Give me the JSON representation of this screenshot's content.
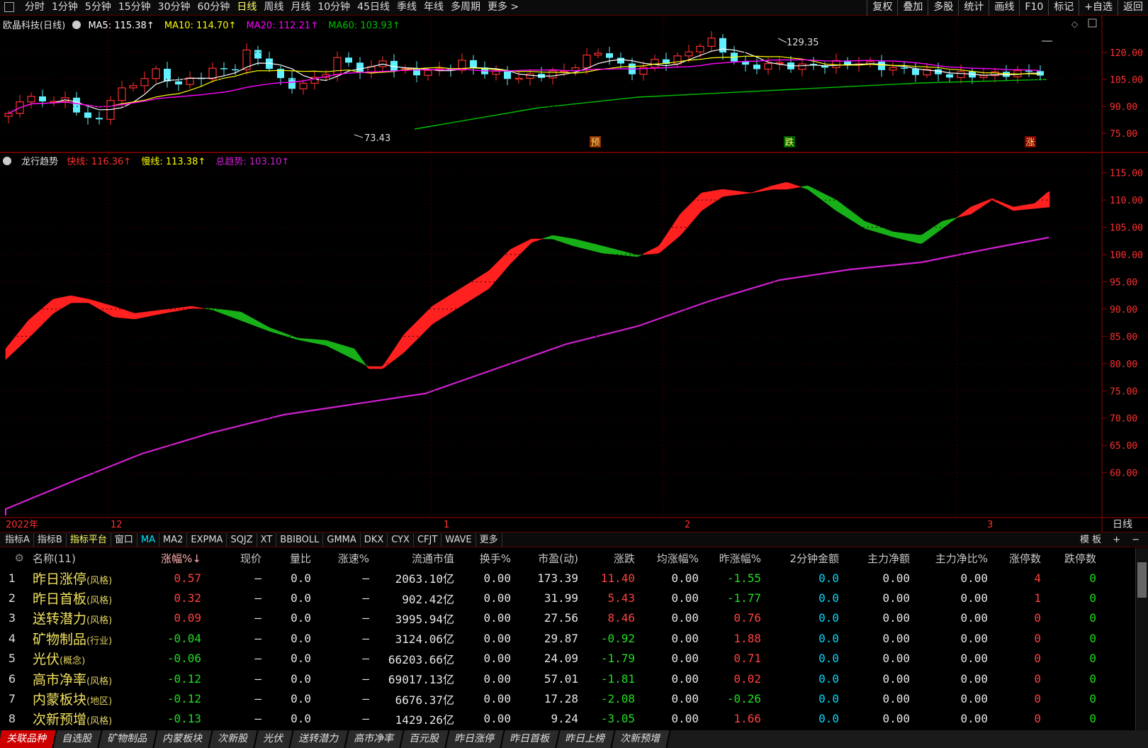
{
  "topbar": {
    "periods": [
      "分时",
      "1分钟",
      "5分钟",
      "15分钟",
      "30分钟",
      "60分钟",
      "日线",
      "周线",
      "月线",
      "10分钟",
      "45日线",
      "季线",
      "年线",
      "多周期",
      "更多 >"
    ],
    "active_period": "日线",
    "tools": [
      "复权",
      "叠加",
      "多股",
      "统计",
      "画线",
      "F10",
      "标记",
      "+自选",
      "返回"
    ]
  },
  "main_legend": {
    "title": "欧晶科技(日线)",
    "ma5": "MA5: 115.38↑",
    "ma10": "MA10: 114.70↑",
    "ma20": "MA20: 112.21↑",
    "ma60": "MA60: 103.93↑"
  },
  "main_chart": {
    "high_label": "129.35",
    "low_label": "73.43",
    "signals": [
      "预",
      "跌",
      "涨"
    ],
    "y_ticks": [
      "120.00",
      "105.00",
      "90.00",
      "75.00"
    ]
  },
  "ind_legend": {
    "title": "龙行趋势",
    "fast": "快线: 116.36↑",
    "slow": "慢线: 113.38↑",
    "total": "总趋势: 103.10↑"
  },
  "ind_chart": {
    "y_ticks": [
      "115.00",
      "110.00",
      "105.00",
      "100.00",
      "95.00",
      "90.00",
      "85.00",
      "80.00",
      "75.00",
      "70.00",
      "65.00",
      "60.00"
    ]
  },
  "x_axis": {
    "labels": [
      "2022年",
      "12",
      "1",
      "2",
      "3"
    ],
    "period": "日线"
  },
  "colors": {
    "up": "#ff2020",
    "down": "#18b018",
    "trend": "#d020d0",
    "ma5": "#ffffff",
    "ma10": "#ffff00",
    "ma20": "#ff00ff",
    "ma60": "#00c000",
    "candle_down": "#60f0ff"
  },
  "indicator_tabs": {
    "tabs": [
      "指标A",
      "指标B",
      "指标平台",
      "窗口",
      "MA",
      "MA2",
      "EXPMA",
      "SQJZ",
      "XT",
      "BBIBOLL",
      "GMMA",
      "DKX",
      "CYX",
      "CFJT",
      "WAVE",
      "更多"
    ],
    "active": "指标平台",
    "right": [
      "模 板",
      "+",
      "−"
    ]
  },
  "table": {
    "headers": [
      "",
      "名称(11)",
      "涨幅%↓",
      "现价",
      "量比",
      "涨速%",
      "流通市值",
      "换手%",
      "市盈(动)",
      "涨跌",
      "均涨幅%",
      "昨涨幅%",
      "2分钟金额",
      "主力净额",
      "主力净比%",
      "涨停数",
      "跌停数"
    ],
    "rows": [
      {
        "idx": "1",
        "name": "昨日涨停",
        "tag": "(风格)",
        "chg": "0.57",
        "price": "—",
        "vr": "0.0",
        "speed": "—",
        "mcap": "2063.10亿",
        "turn": "0.00",
        "pe": "173.39",
        "zd": "11.40",
        "avg": "0.00",
        "yest": "-1.55",
        "amt2": "0.0",
        "net": "0.00",
        "netr": "0.00",
        "up": "4",
        "down": "0"
      },
      {
        "idx": "2",
        "name": "昨日首板",
        "tag": "(风格)",
        "chg": "0.32",
        "price": "—",
        "vr": "0.0",
        "speed": "—",
        "mcap": "902.42亿",
        "turn": "0.00",
        "pe": "31.99",
        "zd": "5.43",
        "avg": "0.00",
        "yest": "-1.77",
        "amt2": "0.0",
        "net": "0.00",
        "netr": "0.00",
        "up": "1",
        "down": "0"
      },
      {
        "idx": "3",
        "name": "送转潜力",
        "tag": "(风格)",
        "chg": "0.09",
        "price": "—",
        "vr": "0.0",
        "speed": "—",
        "mcap": "3995.94亿",
        "turn": "0.00",
        "pe": "27.56",
        "zd": "8.46",
        "avg": "0.00",
        "yest": "0.76",
        "amt2": "0.0",
        "net": "0.00",
        "netr": "0.00",
        "up": "0",
        "down": "0"
      },
      {
        "idx": "4",
        "name": "矿物制品",
        "tag": "(行业)",
        "chg": "-0.04",
        "price": "—",
        "vr": "0.0",
        "speed": "—",
        "mcap": "3124.06亿",
        "turn": "0.00",
        "pe": "29.87",
        "zd": "-0.92",
        "avg": "0.00",
        "yest": "1.88",
        "amt2": "0.0",
        "net": "0.00",
        "netr": "0.00",
        "up": "0",
        "down": "0"
      },
      {
        "idx": "5",
        "name": "光伏",
        "tag": "(概念)",
        "chg": "-0.06",
        "price": "—",
        "vr": "0.0",
        "speed": "—",
        "mcap": "66203.66亿",
        "turn": "0.00",
        "pe": "24.09",
        "zd": "-1.79",
        "avg": "0.00",
        "yest": "0.71",
        "amt2": "0.0",
        "net": "0.00",
        "netr": "0.00",
        "up": "0",
        "down": "0"
      },
      {
        "idx": "6",
        "name": "高市净率",
        "tag": "(风格)",
        "chg": "-0.12",
        "price": "—",
        "vr": "0.0",
        "speed": "—",
        "mcap": "69017.13亿",
        "turn": "0.00",
        "pe": "57.01",
        "zd": "-1.81",
        "avg": "0.00",
        "yest": "0.02",
        "amt2": "0.0",
        "net": "0.00",
        "netr": "0.00",
        "up": "0",
        "down": "0"
      },
      {
        "idx": "7",
        "name": "内蒙板块",
        "tag": "(地区)",
        "chg": "-0.12",
        "price": "—",
        "vr": "0.0",
        "speed": "—",
        "mcap": "6676.37亿",
        "turn": "0.00",
        "pe": "17.28",
        "zd": "-2.08",
        "avg": "0.00",
        "yest": "-0.26",
        "amt2": "0.0",
        "net": "0.00",
        "netr": "0.00",
        "up": "0",
        "down": "0"
      },
      {
        "idx": "8",
        "name": "次新预增",
        "tag": "(风格)",
        "chg": "-0.13",
        "price": "—",
        "vr": "0.0",
        "speed": "—",
        "mcap": "1429.26亿",
        "turn": "0.00",
        "pe": "9.24",
        "zd": "-3.05",
        "avg": "0.00",
        "yest": "1.66",
        "amt2": "0.0",
        "net": "0.00",
        "netr": "0.00",
        "up": "0",
        "down": "0"
      }
    ]
  },
  "bottom_tabs": {
    "tabs": [
      "关联品种",
      "自选股",
      "矿物制品",
      "内蒙板块",
      "次新股",
      "光伏",
      "送转潜力",
      "高市净率",
      "百元股",
      "昨日涨停",
      "昨日首板",
      "昨日上榜",
      "次新预增"
    ],
    "active": "关联品种"
  }
}
